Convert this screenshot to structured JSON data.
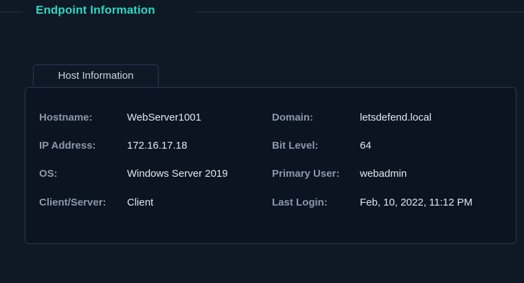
{
  "section": {
    "title": "Endpoint Information"
  },
  "tab": {
    "label": "Host Information"
  },
  "host": {
    "hostname": {
      "label": "Hostname:",
      "value": "WebServer1001"
    },
    "ip_address": {
      "label": "IP Address:",
      "value": "172.16.17.18"
    },
    "os": {
      "label": "OS:",
      "value": "Windows Server 2019"
    },
    "client_server": {
      "label": "Client/Server:",
      "value": "Client"
    },
    "domain": {
      "label": "Domain:",
      "value": "letsdefend.local"
    },
    "bit_level": {
      "label": "Bit Level:",
      "value": "64"
    },
    "primary_user": {
      "label": "Primary User:",
      "value": "webadmin"
    },
    "last_login": {
      "label": "Last Login:",
      "value": "Feb, 10, 2022, 11:12 PM"
    }
  },
  "colors": {
    "background": "#0f1825",
    "panel": "#0c1421",
    "border": "#2a3a55",
    "accent": "#2fd6c3",
    "label": "#8c97ab",
    "value": "#e3e8f0"
  }
}
